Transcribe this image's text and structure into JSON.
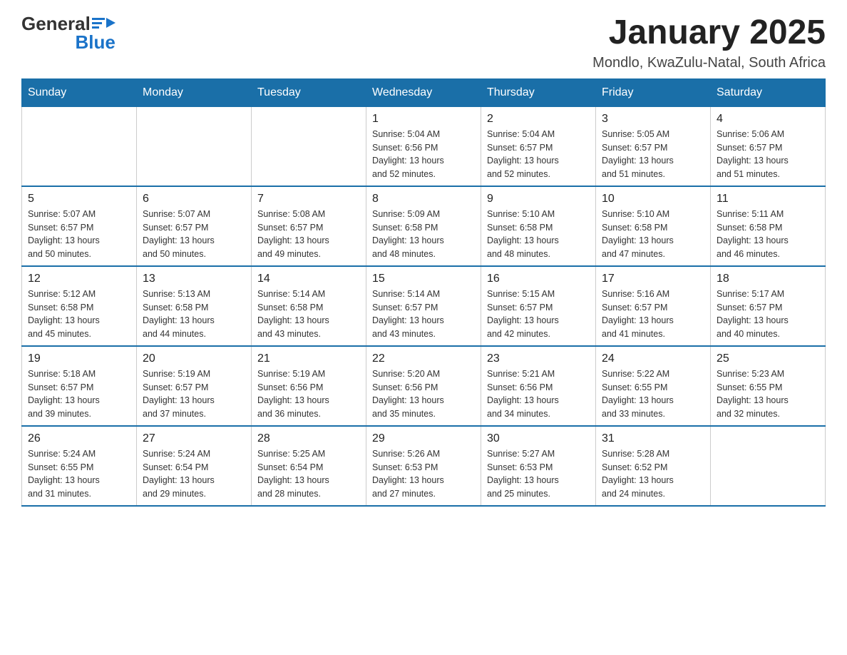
{
  "header": {
    "logo_general": "General",
    "logo_blue": "Blue",
    "title": "January 2025",
    "subtitle": "Mondlo, KwaZulu-Natal, South Africa"
  },
  "days_of_week": [
    "Sunday",
    "Monday",
    "Tuesday",
    "Wednesday",
    "Thursday",
    "Friday",
    "Saturday"
  ],
  "weeks": [
    {
      "days": [
        {
          "num": "",
          "info": ""
        },
        {
          "num": "",
          "info": ""
        },
        {
          "num": "",
          "info": ""
        },
        {
          "num": "1",
          "info": "Sunrise: 5:04 AM\nSunset: 6:56 PM\nDaylight: 13 hours\nand 52 minutes."
        },
        {
          "num": "2",
          "info": "Sunrise: 5:04 AM\nSunset: 6:57 PM\nDaylight: 13 hours\nand 52 minutes."
        },
        {
          "num": "3",
          "info": "Sunrise: 5:05 AM\nSunset: 6:57 PM\nDaylight: 13 hours\nand 51 minutes."
        },
        {
          "num": "4",
          "info": "Sunrise: 5:06 AM\nSunset: 6:57 PM\nDaylight: 13 hours\nand 51 minutes."
        }
      ]
    },
    {
      "days": [
        {
          "num": "5",
          "info": "Sunrise: 5:07 AM\nSunset: 6:57 PM\nDaylight: 13 hours\nand 50 minutes."
        },
        {
          "num": "6",
          "info": "Sunrise: 5:07 AM\nSunset: 6:57 PM\nDaylight: 13 hours\nand 50 minutes."
        },
        {
          "num": "7",
          "info": "Sunrise: 5:08 AM\nSunset: 6:57 PM\nDaylight: 13 hours\nand 49 minutes."
        },
        {
          "num": "8",
          "info": "Sunrise: 5:09 AM\nSunset: 6:58 PM\nDaylight: 13 hours\nand 48 minutes."
        },
        {
          "num": "9",
          "info": "Sunrise: 5:10 AM\nSunset: 6:58 PM\nDaylight: 13 hours\nand 48 minutes."
        },
        {
          "num": "10",
          "info": "Sunrise: 5:10 AM\nSunset: 6:58 PM\nDaylight: 13 hours\nand 47 minutes."
        },
        {
          "num": "11",
          "info": "Sunrise: 5:11 AM\nSunset: 6:58 PM\nDaylight: 13 hours\nand 46 minutes."
        }
      ]
    },
    {
      "days": [
        {
          "num": "12",
          "info": "Sunrise: 5:12 AM\nSunset: 6:58 PM\nDaylight: 13 hours\nand 45 minutes."
        },
        {
          "num": "13",
          "info": "Sunrise: 5:13 AM\nSunset: 6:58 PM\nDaylight: 13 hours\nand 44 minutes."
        },
        {
          "num": "14",
          "info": "Sunrise: 5:14 AM\nSunset: 6:58 PM\nDaylight: 13 hours\nand 43 minutes."
        },
        {
          "num": "15",
          "info": "Sunrise: 5:14 AM\nSunset: 6:57 PM\nDaylight: 13 hours\nand 43 minutes."
        },
        {
          "num": "16",
          "info": "Sunrise: 5:15 AM\nSunset: 6:57 PM\nDaylight: 13 hours\nand 42 minutes."
        },
        {
          "num": "17",
          "info": "Sunrise: 5:16 AM\nSunset: 6:57 PM\nDaylight: 13 hours\nand 41 minutes."
        },
        {
          "num": "18",
          "info": "Sunrise: 5:17 AM\nSunset: 6:57 PM\nDaylight: 13 hours\nand 40 minutes."
        }
      ]
    },
    {
      "days": [
        {
          "num": "19",
          "info": "Sunrise: 5:18 AM\nSunset: 6:57 PM\nDaylight: 13 hours\nand 39 minutes."
        },
        {
          "num": "20",
          "info": "Sunrise: 5:19 AM\nSunset: 6:57 PM\nDaylight: 13 hours\nand 37 minutes."
        },
        {
          "num": "21",
          "info": "Sunrise: 5:19 AM\nSunset: 6:56 PM\nDaylight: 13 hours\nand 36 minutes."
        },
        {
          "num": "22",
          "info": "Sunrise: 5:20 AM\nSunset: 6:56 PM\nDaylight: 13 hours\nand 35 minutes."
        },
        {
          "num": "23",
          "info": "Sunrise: 5:21 AM\nSunset: 6:56 PM\nDaylight: 13 hours\nand 34 minutes."
        },
        {
          "num": "24",
          "info": "Sunrise: 5:22 AM\nSunset: 6:55 PM\nDaylight: 13 hours\nand 33 minutes."
        },
        {
          "num": "25",
          "info": "Sunrise: 5:23 AM\nSunset: 6:55 PM\nDaylight: 13 hours\nand 32 minutes."
        }
      ]
    },
    {
      "days": [
        {
          "num": "26",
          "info": "Sunrise: 5:24 AM\nSunset: 6:55 PM\nDaylight: 13 hours\nand 31 minutes."
        },
        {
          "num": "27",
          "info": "Sunrise: 5:24 AM\nSunset: 6:54 PM\nDaylight: 13 hours\nand 29 minutes."
        },
        {
          "num": "28",
          "info": "Sunrise: 5:25 AM\nSunset: 6:54 PM\nDaylight: 13 hours\nand 28 minutes."
        },
        {
          "num": "29",
          "info": "Sunrise: 5:26 AM\nSunset: 6:53 PM\nDaylight: 13 hours\nand 27 minutes."
        },
        {
          "num": "30",
          "info": "Sunrise: 5:27 AM\nSunset: 6:53 PM\nDaylight: 13 hours\nand 25 minutes."
        },
        {
          "num": "31",
          "info": "Sunrise: 5:28 AM\nSunset: 6:52 PM\nDaylight: 13 hours\nand 24 minutes."
        },
        {
          "num": "",
          "info": ""
        }
      ]
    }
  ]
}
